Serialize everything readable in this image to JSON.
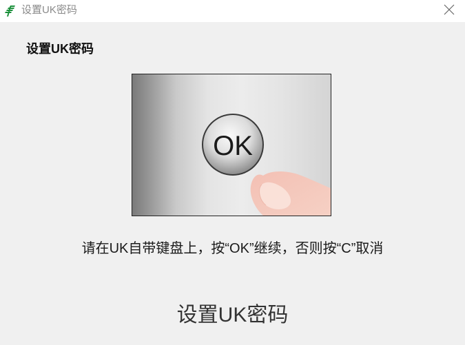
{
  "window": {
    "title": "设置UK密码"
  },
  "dialog": {
    "heading": "设置UK密码",
    "illustration": {
      "button_label": "OK"
    },
    "instruction": "请在UK自带键盘上，按“OK”继续，否则按“C”取消",
    "bottom_title": "设置UK密码"
  },
  "colors": {
    "brand_green": "#1a8f3a",
    "background": "#f0f0f0",
    "titlebar": "#ffffff"
  },
  "icons": {
    "app": "bank-logo-icon",
    "close": "close-icon",
    "finger": "finger-icon"
  }
}
